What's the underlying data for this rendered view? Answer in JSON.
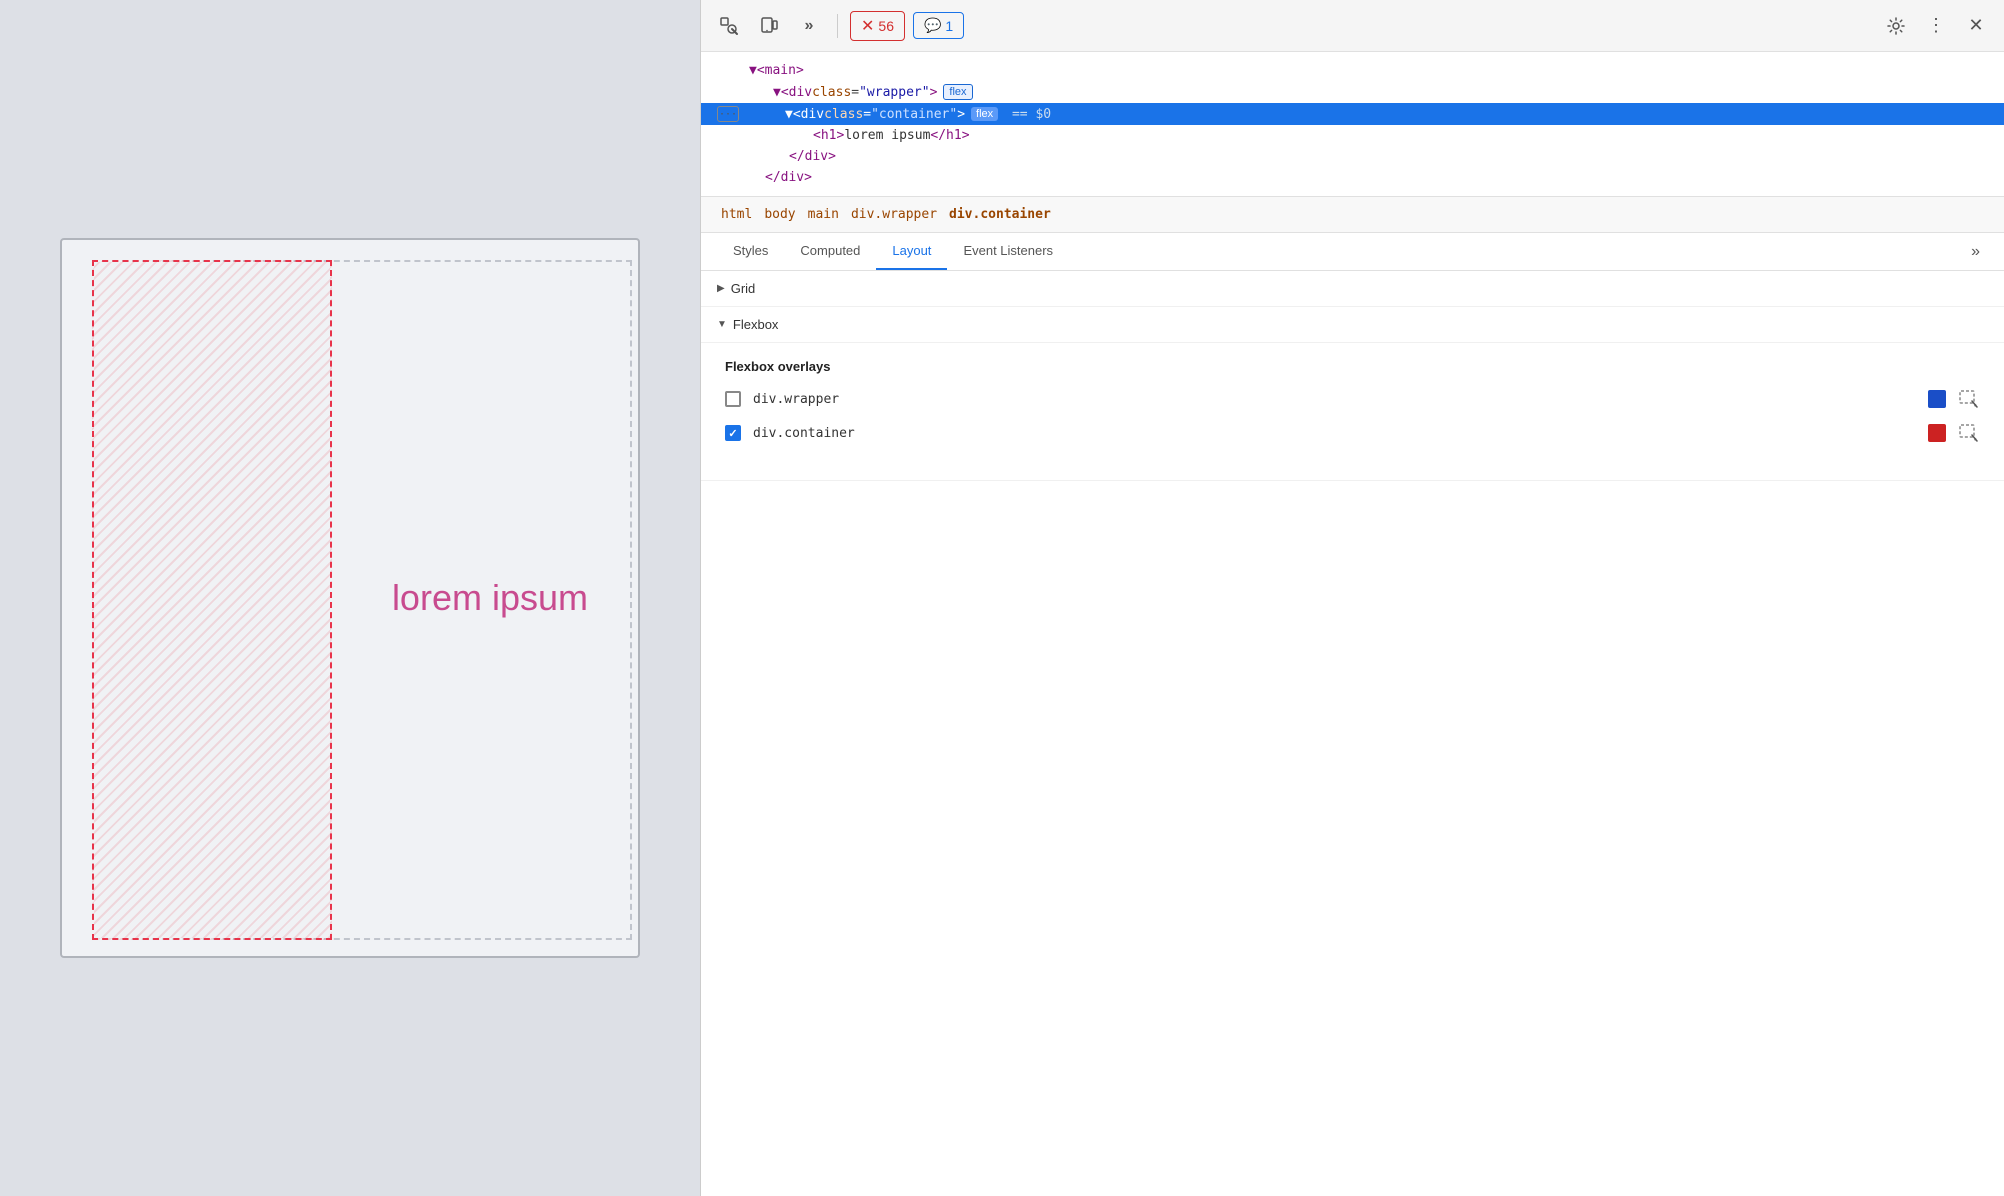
{
  "preview": {
    "lorem_text": "lorem ipsum"
  },
  "devtools": {
    "toolbar": {
      "inspect_icon": "⬚",
      "device_icon": "⧠",
      "more_tools_icon": "»",
      "error_count": "56",
      "info_count": "1",
      "settings_icon": "⚙",
      "more_icon": "⋮",
      "close_icon": "✕"
    },
    "dom_tree": {
      "rows": [
        {
          "indent": 0,
          "content": "▼<main>",
          "selected": false,
          "badges": []
        },
        {
          "indent": 1,
          "content": "▼<div class=\"wrapper\">",
          "selected": false,
          "badges": [
            {
              "label": "flex",
              "type": "outline"
            }
          ]
        },
        {
          "indent": 2,
          "content": "<div class=\"container\">",
          "selected": true,
          "badges": [
            {
              "label": "flex",
              "type": "filled"
            }
          ],
          "has_dollar": true,
          "has_ellipsis": true
        },
        {
          "indent": 3,
          "content": "<h1>lorem ipsum</h1>",
          "selected": false,
          "badges": []
        },
        {
          "indent": 2,
          "content": "</div>",
          "selected": false,
          "badges": []
        },
        {
          "indent": 1,
          "content": "</div>",
          "selected": false,
          "badges": []
        }
      ]
    },
    "breadcrumb": {
      "items": [
        "html",
        "body",
        "main",
        "div.wrapper",
        "div.container"
      ]
    },
    "tabs": {
      "items": [
        "Styles",
        "Computed",
        "Layout",
        "Event Listeners"
      ],
      "active": "Layout",
      "more_label": "»"
    },
    "layout": {
      "grid_section": {
        "label": "Grid",
        "collapsed": true
      },
      "flexbox_section": {
        "label": "Flexbox",
        "collapsed": false,
        "overlays_title": "Flexbox overlays",
        "items": [
          {
            "label": "div.wrapper",
            "checked": false,
            "color": "#1a4ec7",
            "color_hex": "#1a4ec7"
          },
          {
            "label": "div.container",
            "checked": true,
            "color": "#cc2222",
            "color_hex": "#cc2222"
          }
        ]
      }
    }
  }
}
